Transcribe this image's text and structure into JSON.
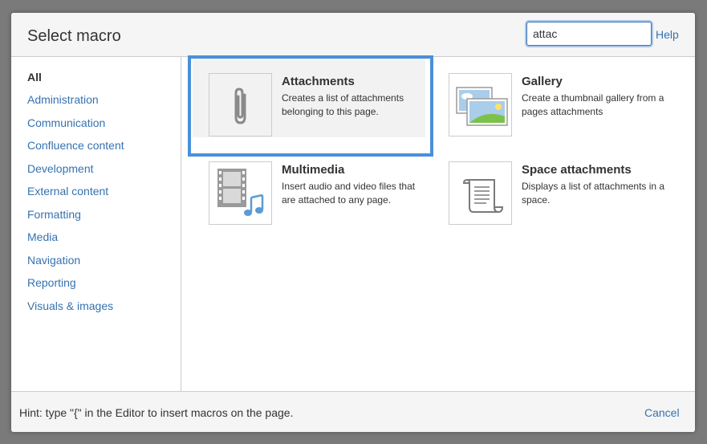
{
  "dialog": {
    "title": "Select macro",
    "search": {
      "value": "attac",
      "placeholder": ""
    },
    "help_label": "Help"
  },
  "sidebar": {
    "items": [
      {
        "label": "All",
        "active": true
      },
      {
        "label": "Administration"
      },
      {
        "label": "Communication"
      },
      {
        "label": "Confluence content"
      },
      {
        "label": "Development"
      },
      {
        "label": "External content"
      },
      {
        "label": "Formatting"
      },
      {
        "label": "Media"
      },
      {
        "label": "Navigation"
      },
      {
        "label": "Reporting"
      },
      {
        "label": "Visuals & images"
      }
    ]
  },
  "macros": [
    {
      "title": "Attachments",
      "description": "Creates a list of attachments belonging to this page.",
      "icon": "paperclip-icon",
      "selected": true
    },
    {
      "title": "Gallery",
      "description": "Create a thumbnail gallery from a pages attachments",
      "icon": "gallery-icon"
    },
    {
      "title": "Multimedia",
      "description": "Insert audio and video files that are attached to any page.",
      "icon": "multimedia-icon"
    },
    {
      "title": "Space attachments",
      "description": "Displays a list of attachments in a space.",
      "icon": "scroll-icon"
    }
  ],
  "footer": {
    "hint": "Hint: type \"{\" in the Editor to insert macros on the page.",
    "cancel_label": "Cancel"
  },
  "colors": {
    "link": "#3572b0",
    "highlight": "#4a90d9"
  }
}
